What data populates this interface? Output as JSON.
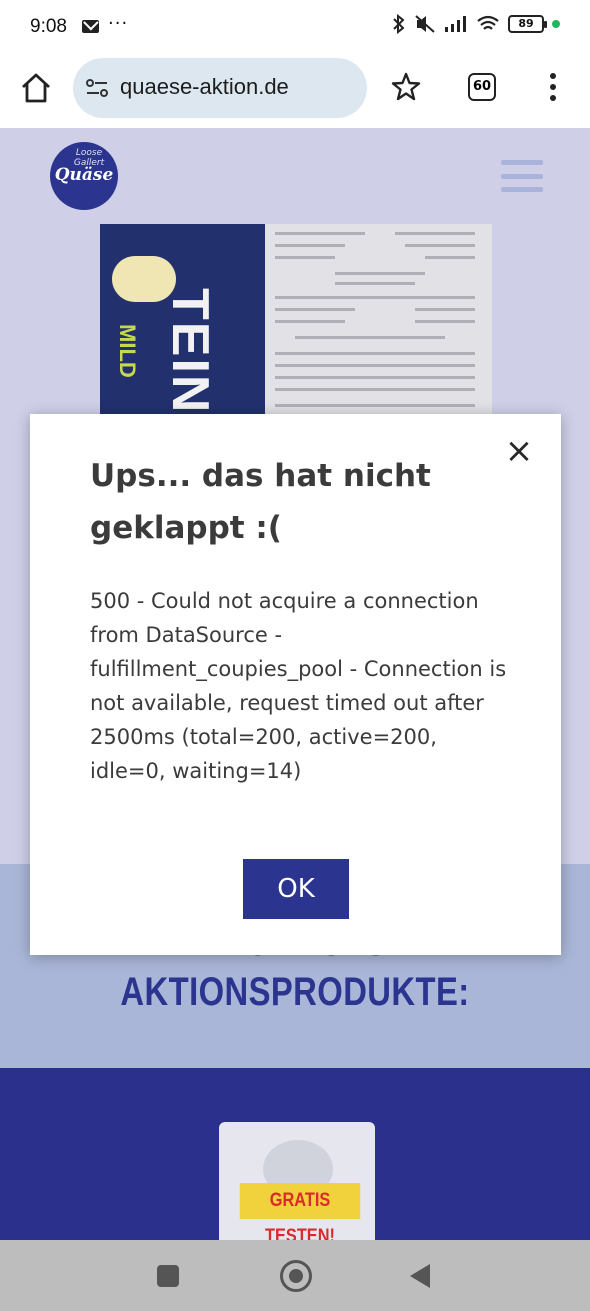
{
  "status_bar": {
    "time": "9:08",
    "dots": "···",
    "battery": "89",
    "icons": [
      "mail-icon",
      "bluetooth-icon",
      "mute-icon",
      "signal-icon",
      "wifi-icon",
      "battery-icon"
    ]
  },
  "browser": {
    "url": "quaese-aktion.de",
    "tab_count": "60",
    "icons": [
      "home-icon",
      "site-settings-icon",
      "star-icon",
      "tabs-icon",
      "more-vert-icon"
    ]
  },
  "site": {
    "logo_text": "Quäse",
    "logo_top": "Loose Gallert",
    "promo_title_partial": "ENTDECKE UNSERE",
    "promo_title": "AKTIONSPRODUKTE:",
    "product_badge": "GRATIS TESTEN!",
    "package_word": "TEIN",
    "package_sub": "MILD"
  },
  "modal": {
    "title": "Ups... das hat nicht geklappt :(",
    "message": "500 - Could not acquire a connection from DataSource - fulfillment_coupies_pool - Connection is not available, request timed out after 2500ms (total=200, active=200, idle=0, waiting=14)",
    "ok_label": "OK",
    "close_symbol": "×"
  },
  "colors": {
    "brand": "#2b3590",
    "page_bg": "#cfcfe8",
    "promo_band": "#aab6d8",
    "products_band": "#2b308c",
    "badge_bg": "#f2d23c",
    "badge_text": "#d92b2b"
  }
}
